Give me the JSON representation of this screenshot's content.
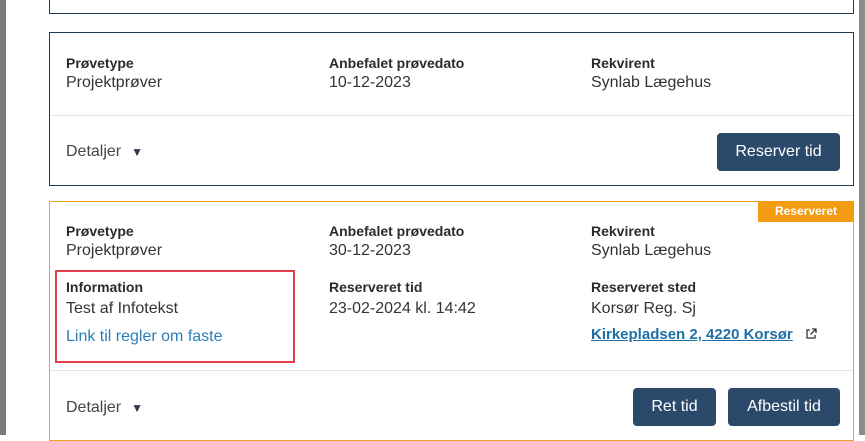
{
  "card1": {
    "test_type_label": "Prøvetype",
    "test_type_value": "Projektprøver",
    "recommended_date_label": "Anbefalet prøvedato",
    "recommended_date_value": "10-12-2023",
    "requester_label": "Rekvirent",
    "requester_value": "Synlab Lægehus",
    "details_label": "Detaljer",
    "details_caret": "▼",
    "reserve_button": "Reserver tid"
  },
  "card2": {
    "badge": "Reserveret",
    "test_type_label": "Prøvetype",
    "test_type_value": "Projektprøver",
    "recommended_date_label": "Anbefalet prøvedato",
    "recommended_date_value": "30-12-2023",
    "requester_label": "Rekvirent",
    "requester_value": "Synlab Lægehus",
    "information_label": "Information",
    "information_value": "Test af Infotekst",
    "information_link": "Link til regler om faste",
    "reserved_time_label": "Reserveret tid",
    "reserved_time_value": "23-02-2024 kl. 14:42",
    "reserved_place_label": "Reserveret sted",
    "reserved_place_value": "Korsør Reg. Sj",
    "reserved_place_address": "Kirkepladsen 2, 4220 Korsør",
    "details_label": "Detaljer",
    "details_caret": "▼",
    "change_button": "Ret tid",
    "cancel_button": "Afbestil tid"
  },
  "colors": {
    "primary_button": "#2b4a6b",
    "reserved_accent": "#f39c12",
    "link": "#2a7fb8",
    "highlight": "#e0404a"
  }
}
